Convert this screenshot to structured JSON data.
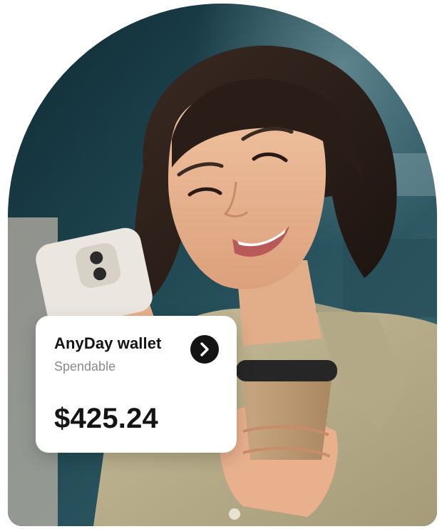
{
  "photo": {
    "subject": "woman-smiling-at-phone-holding-coffee-photo"
  },
  "wallet_card": {
    "title": "AnyDay wallet",
    "subtitle": "Spendable",
    "balance": "$425.24",
    "arrow_icon": "chevron-right-icon"
  },
  "colors": {
    "card_background": "#ffffff",
    "text_primary": "#141414",
    "text_secondary": "#8a8a8a",
    "arrow_button": "#141414"
  }
}
